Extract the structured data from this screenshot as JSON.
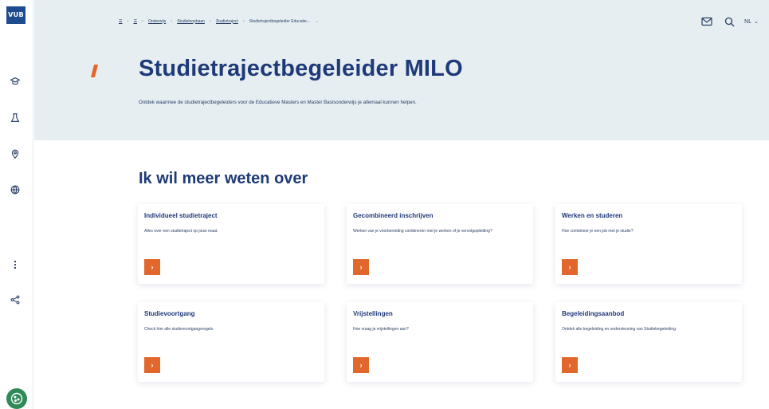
{
  "rail": {
    "logo_text": "VUB",
    "icons": [
      "student-cap-icon",
      "lab-flask-icon",
      "location-pin-icon",
      "globe-icon",
      "more-vertical-icon",
      "share-icon"
    ],
    "avatar_icon": "cookie-icon"
  },
  "header": {
    "breadcrumb": [
      "☰",
      "☰",
      "Onderwijs",
      "Studieloopbaan",
      "Studietraject",
      "Studietrajectbegeleider Educatie..."
    ],
    "tools": {
      "mail_icon": "mail-icon",
      "search_icon": "search-icon",
      "language": "NL"
    },
    "title": "Studietrajectbegeleider MILO",
    "intro": "Ontdek waarmee de studietrajectbegeleiders voor de Educatieve Masters en Master Basisonderwijs je allemaal kunnen helpen."
  },
  "main": {
    "section_title": "Ik wil meer weten over",
    "cards": [
      {
        "title": "Individueel studietraject",
        "text": "Alles over een studietraject op jouw maat.",
        "button_icon": "chevron-right-icon"
      },
      {
        "title": "Gecombineerd inschrijven",
        "text": "Werken van je voorbereiding combineren met je werken of je vervolgopleiding?",
        "button_icon": "chevron-right-icon"
      },
      {
        "title": "Werken en studeren",
        "text": "Hoe combineer je een job met je studie?",
        "button_icon": "chevron-right-icon"
      },
      {
        "title": "Studievoortgang",
        "text": "Check hier alle studievoortgangsregels.",
        "button_icon": "chevron-right-icon"
      },
      {
        "title": "Vrijstellingen",
        "text": "Hoe vraag je vrijstellingen aan?",
        "button_icon": "chevron-right-icon"
      },
      {
        "title": "Begeleidingsaanbod",
        "text": "Ontdek alle begeleiding en ondersteuning van Studiebegeleiding.",
        "button_icon": "chevron-right-icon"
      }
    ]
  },
  "colors": {
    "brand_blue": "#1e3a78",
    "accent_orange": "#e2672d",
    "header_bg": "#e6eef1"
  }
}
